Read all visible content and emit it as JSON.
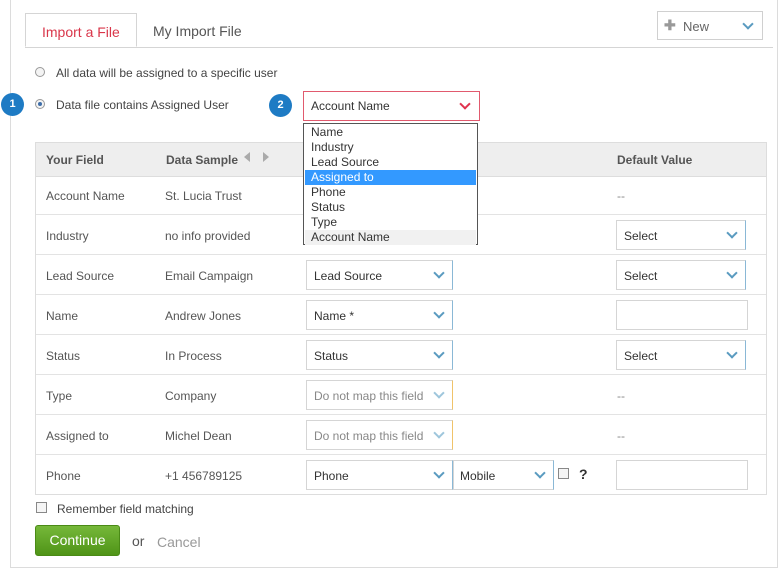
{
  "tabs": {
    "import_file": "Import a File",
    "my_import_file": "My Import File"
  },
  "new_button": {
    "label": "New",
    "icon": "plus-icon"
  },
  "options": {
    "specific_user": "All data will be assigned to a specific user",
    "assigned_user": "Data file contains Assigned User",
    "selected": "assigned_user"
  },
  "steps": {
    "one": "1",
    "two": "2"
  },
  "assigned_select": {
    "value": "Account Name",
    "options": [
      "Name",
      "Industry",
      "Lead Source",
      "Assigned to",
      "Phone",
      "Status",
      "Type",
      "Account Name"
    ],
    "highlighted": "Assigned to"
  },
  "table": {
    "headers": {
      "your_field": "Your Field",
      "data_sample": "Data Sample",
      "default_value": "Default Value"
    },
    "rows": [
      {
        "field": "Account Name",
        "sample": "St. Lucia Trust",
        "default": "--"
      },
      {
        "field": "Industry",
        "sample": "no info provided",
        "default": "Select"
      },
      {
        "field": "Lead Source",
        "sample": "Email Campaign",
        "mapping": "Lead Source",
        "default": "Select"
      },
      {
        "field": "Name",
        "sample": "Andrew Jones",
        "mapping": "Name *",
        "default": ""
      },
      {
        "field": "Status",
        "sample": "In Process",
        "mapping": "Status",
        "default": "Select"
      },
      {
        "field": "Type",
        "sample": "Company",
        "mapping": "Do not map this field",
        "default": "--"
      },
      {
        "field": "Assigned to",
        "sample": "Michel Dean",
        "mapping": "Do not map this field",
        "default": "--"
      },
      {
        "field": "Phone",
        "sample": "+1 456789125",
        "mapping": "Phone",
        "sub_mapping": "Mobile",
        "help": "?",
        "default": ""
      }
    ]
  },
  "remember": {
    "label": "Remember field matching",
    "checked": false
  },
  "actions": {
    "continue": "Continue",
    "or": "or",
    "cancel": "Cancel"
  },
  "colors": {
    "accent": "#d9364a",
    "primary": "#5aa21d",
    "step": "#1e7bc4",
    "highlight": "#3399ff"
  }
}
